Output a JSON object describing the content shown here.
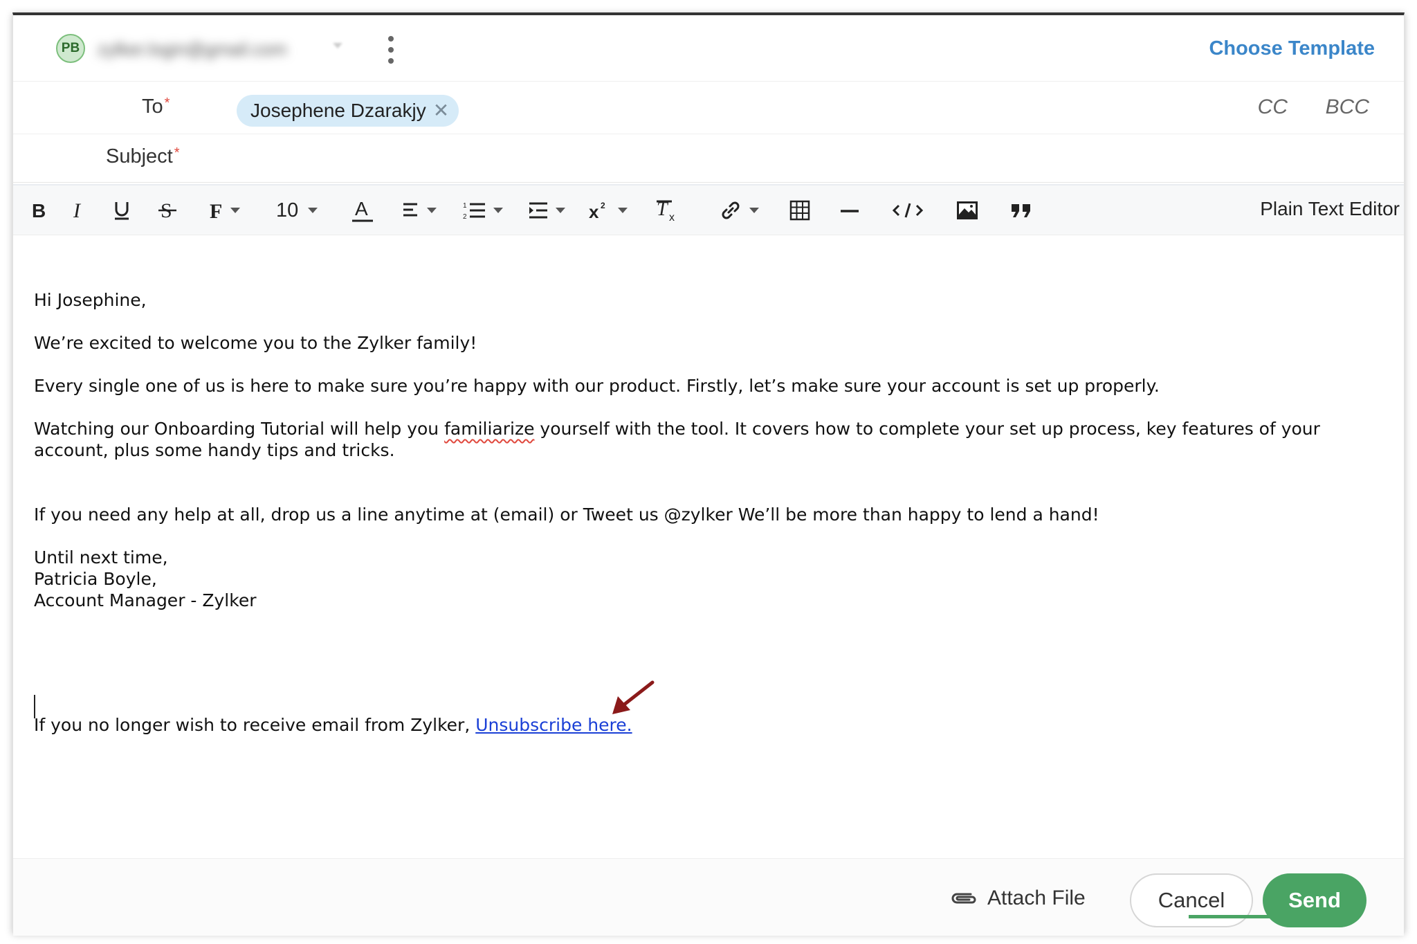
{
  "from": {
    "avatar_initials": "PB",
    "email": "zylker.login@gmail.com"
  },
  "header": {
    "choose_template": "Choose Template"
  },
  "to": {
    "label": "To",
    "required_mark": "*",
    "recipients": [
      "Josephene Dzarakjy"
    ],
    "remove_glyph": "✕",
    "cc_label": "CC",
    "bcc_label": "BCC"
  },
  "subject": {
    "label": "Subject",
    "required_mark": "*",
    "value": ""
  },
  "toolbar": {
    "font_size": "10",
    "plain_text_label": "Plain Text Editor",
    "buttons": [
      "bold-icon",
      "italic-icon",
      "underline-icon",
      "strikethrough-icon",
      "font-family-icon",
      "font-size",
      "font-color-icon",
      "align-icon",
      "numbered-list-icon",
      "indent-icon",
      "superscript-icon",
      "clear-format-icon",
      "link-icon",
      "table-icon",
      "horizontal-rule-icon",
      "code-icon",
      "image-icon",
      "quote-icon"
    ]
  },
  "body": {
    "greeting": "Hi Josephine,",
    "line1": "We’re excited to welcome you to the Zylker family!",
    "line2": "Every single one of us is here to make sure you’re happy with our product. Firstly, let’s make sure your account is set up properly.",
    "line3_before": "Watching our Onboarding Tutorial will help you ",
    "line3_misspelled": "familiarize",
    "line3_after": " yourself with the tool. It covers how to complete your set up process, key features of your account, plus some handy tips and tricks.",
    "line4": "If you need any help at all, drop us a line anytime at (email) or Tweet us @zylker We’ll be more than happy to lend a hand!",
    "signoff": "Until next time,",
    "sender_name": "Patricia Boyle,",
    "sender_title": "Account Manager - Zylker",
    "unsubscribe_text": "If you no longer wish to receive email from Zylker, ",
    "unsubscribe_link": "Unsubscribe here."
  },
  "footer": {
    "attach_label": "Attach File",
    "cancel_label": "Cancel",
    "send_label": "Send"
  },
  "colors": {
    "accent_blue": "#3b86c9",
    "send_green": "#4aa464",
    "chip_bg": "#d6ebf8",
    "required_red": "#e0483d",
    "annotation_arrow": "#8b1a1a"
  }
}
